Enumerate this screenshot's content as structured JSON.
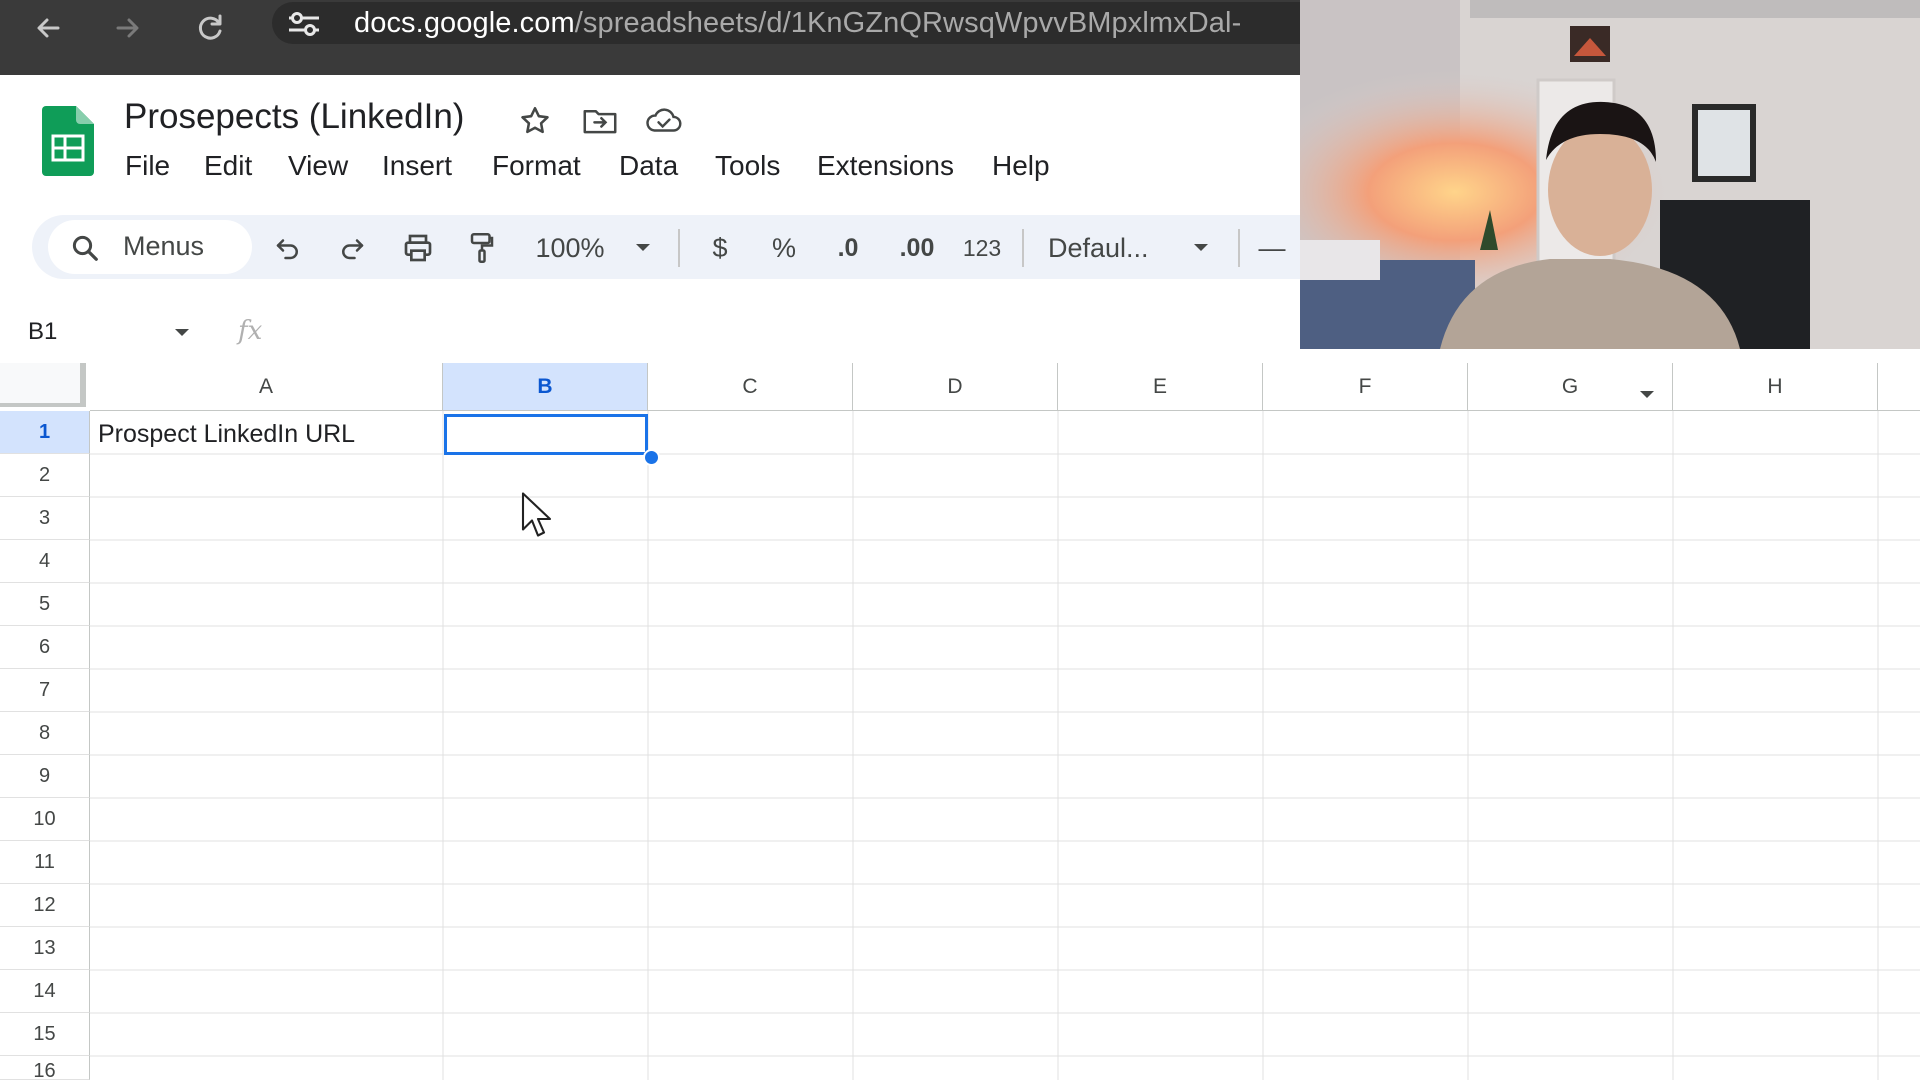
{
  "browser": {
    "url_domain": "docs.google.com",
    "url_path": "/spreadsheets/d/1KnGZnQRwsqWpvvBMpxlmxDal-",
    "icons": [
      "back-arrow-icon",
      "forward-arrow-icon",
      "reload-icon",
      "site-settings-icon"
    ]
  },
  "sheets": {
    "title": "Prosepects (LinkedIn)",
    "title_icons": [
      "star-icon",
      "move-folder-icon",
      "cloud-status-icon"
    ],
    "menu": [
      "File",
      "Edit",
      "View",
      "Insert",
      "Format",
      "Data",
      "Tools",
      "Extensions",
      "Help"
    ],
    "toolbar": {
      "search_label": "Menus",
      "zoom": "100%",
      "currency": "$",
      "percent": "%",
      "decrease_decimal": ".0",
      "increase_decimal": ".00",
      "number_format": "123",
      "font": "Defaul...",
      "minus": "—"
    },
    "formula_bar": {
      "name_box": "B1",
      "fx": "fx"
    },
    "columns": [
      "A",
      "B",
      "C",
      "D",
      "E",
      "F",
      "G",
      "H"
    ],
    "selected_column": "B",
    "rows": [
      "1",
      "2",
      "3",
      "4",
      "5",
      "6",
      "7",
      "8",
      "9",
      "10",
      "11",
      "12",
      "13",
      "14",
      "15",
      "16"
    ],
    "selected_row": "1",
    "cells": {
      "A1": "Prospect LinkedIn URL"
    }
  },
  "colors": {
    "accent": "#1a73e8",
    "selection_header_bg": "#d3e3fd",
    "browser_bar": "#3a3a3a",
    "toolbar_bg": "#eef2f9",
    "sheets_green": "#0f9d58"
  }
}
